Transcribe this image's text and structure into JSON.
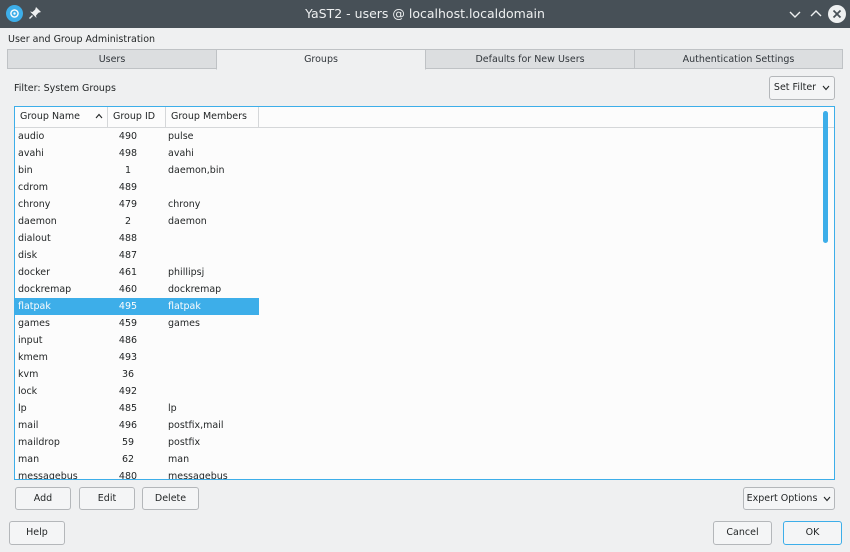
{
  "window": {
    "title": "YaST2 - users @ localhost.localdomain"
  },
  "heading": "User and Group Administration",
  "tabs": [
    {
      "label": "Users",
      "active": false
    },
    {
      "label": "Groups",
      "active": true
    },
    {
      "label": "Defaults for New Users",
      "active": false
    },
    {
      "label": "Authentication Settings",
      "active": false
    }
  ],
  "filter": {
    "label": "Filter: System Groups",
    "button_label": "Set Filter"
  },
  "table": {
    "columns": [
      "Group Name",
      "Group ID",
      "Group Members"
    ],
    "selected_index": 10,
    "rows": [
      {
        "name": "audio",
        "id": "490",
        "members": "pulse"
      },
      {
        "name": "avahi",
        "id": "498",
        "members": "avahi"
      },
      {
        "name": "bin",
        "id": "1",
        "members": "daemon,bin"
      },
      {
        "name": "cdrom",
        "id": "489",
        "members": ""
      },
      {
        "name": "chrony",
        "id": "479",
        "members": "chrony"
      },
      {
        "name": "daemon",
        "id": "2",
        "members": "daemon"
      },
      {
        "name": "dialout",
        "id": "488",
        "members": ""
      },
      {
        "name": "disk",
        "id": "487",
        "members": ""
      },
      {
        "name": "docker",
        "id": "461",
        "members": "phillipsj"
      },
      {
        "name": "dockremap",
        "id": "460",
        "members": "dockremap"
      },
      {
        "name": "flatpak",
        "id": "495",
        "members": "flatpak"
      },
      {
        "name": "games",
        "id": "459",
        "members": "games"
      },
      {
        "name": "input",
        "id": "486",
        "members": ""
      },
      {
        "name": "kmem",
        "id": "493",
        "members": ""
      },
      {
        "name": "kvm",
        "id": "36",
        "members": ""
      },
      {
        "name": "lock",
        "id": "492",
        "members": ""
      },
      {
        "name": "lp",
        "id": "485",
        "members": "lp"
      },
      {
        "name": "mail",
        "id": "496",
        "members": "postfix,mail"
      },
      {
        "name": "maildrop",
        "id": "59",
        "members": "postfix"
      },
      {
        "name": "man",
        "id": "62",
        "members": "man"
      },
      {
        "name": "messagebus",
        "id": "480",
        "members": "messagebus"
      }
    ]
  },
  "actions": {
    "add": "Add",
    "edit": "Edit",
    "delete": "Delete",
    "expert_options": "Expert Options"
  },
  "footer": {
    "help": "Help",
    "cancel": "Cancel",
    "ok": "OK"
  },
  "colors": {
    "accent": "#3daee9",
    "titlebar": "#475057"
  }
}
